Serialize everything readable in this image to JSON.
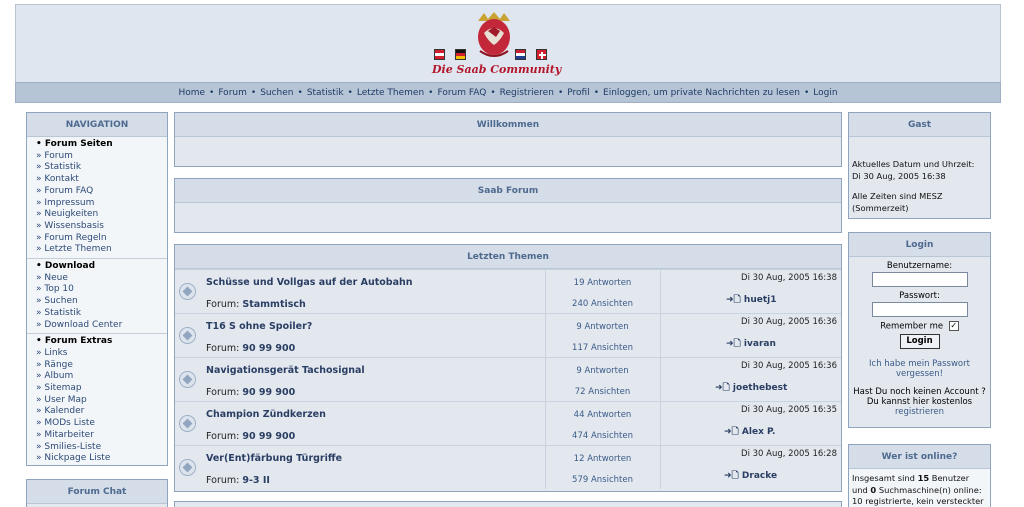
{
  "header": {
    "logo_text": "Die Saab Community"
  },
  "navbar": {
    "links": [
      "Home",
      "Forum",
      "Suchen",
      "Statistik",
      "Letzte Themen",
      "Forum FAQ",
      "Registrieren",
      "Profil",
      "Einloggen, um private Nachrichten zu lesen",
      "Login"
    ]
  },
  "navigation": {
    "title": "NAVIGATION",
    "sections": [
      {
        "title": "Forum Seiten",
        "items": [
          "Forum",
          "Statistik",
          "Kontakt",
          "Forum FAQ",
          "Impressum",
          "Neuigkeiten",
          "Wissensbasis",
          "Forum Regeln",
          "Letzte Themen"
        ]
      },
      {
        "title": "Download",
        "items": [
          "Neue",
          "Top 10",
          "Suchen",
          "Statistik",
          "Download Center"
        ]
      },
      {
        "title": "Forum Extras",
        "items": [
          "Links",
          "Ränge",
          "Album",
          "Sitemap",
          "User Map",
          "Kalender",
          "MODs Liste",
          "Mitarbeiter",
          "Smilies-Liste",
          "Nickpage Liste"
        ]
      }
    ]
  },
  "forum_chat": {
    "title": "Forum Chat"
  },
  "welcome": {
    "title": "Willkommen"
  },
  "saab_forum": {
    "title": "Saab Forum"
  },
  "latest": {
    "title": "Letzten Themen",
    "rows": [
      {
        "title": "Schüsse und Vollgas auf der Autobahn",
        "forum_label": "Forum:",
        "forum": "Stammtisch",
        "answers": "19 Antworten",
        "views": "240 Ansichten",
        "date": "Di 30 Aug, 2005 16:38",
        "user": "huetj1"
      },
      {
        "title": "T16 S ohne Spoiler?",
        "forum_label": "Forum:",
        "forum": "90 99 900",
        "answers": "9 Antworten",
        "views": "117 Ansichten",
        "date": "Di 30 Aug, 2005 16:36",
        "user": "ivaran"
      },
      {
        "title": "Navigationsgerät Tachosignal",
        "forum_label": "Forum:",
        "forum": "90 99 900",
        "answers": "9 Antworten",
        "views": "72 Ansichten",
        "date": "Di 30 Aug, 2005 16:36",
        "user": "joethebest"
      },
      {
        "title": "Champion Zündkerzen",
        "forum_label": "Forum:",
        "forum": "90 99 900",
        "answers": "44 Antworten",
        "views": "474 Ansichten",
        "date": "Di 30 Aug, 2005 16:35",
        "user": "Alex P."
      },
      {
        "title": "Ver(Ent)färbung Türgriffe",
        "forum_label": "Forum:",
        "forum": "9-3 II",
        "answers": "12 Antworten",
        "views": "579 Ansichten",
        "date": "Di 30 Aug, 2005 16:28",
        "user": "Dracke"
      }
    ]
  },
  "guest": {
    "title": "Gast",
    "date_label": "Aktuelles Datum und Uhrzeit:",
    "date_value": "Di 30 Aug, 2005 16:38",
    "tz_line1": "Alle Zeiten sind MESZ",
    "tz_line2": "(Sommerzeit)"
  },
  "login": {
    "title": "Login",
    "username_label": "Benutzername:",
    "password_label": "Passwort:",
    "remember_label": "Remember me",
    "button": "Login",
    "forgot_line1": "Ich habe mein Passwort",
    "forgot_line2": "vergessen!",
    "no_account_line1": "Hast Du noch keinen Account ?",
    "no_account_line2": "Du kannst hier kostenlos",
    "register_link": "registrieren"
  },
  "online": {
    "title": "Wer ist online?",
    "line1_pre": "Insgesamt sind ",
    "line1_num": "15",
    "line1_post": " Benutzer",
    "line2_pre": "und ",
    "line2_num": "0",
    "line2_post": " Suchmaschine(n) online:",
    "line3": "10 registrierte, kein versteckter"
  }
}
